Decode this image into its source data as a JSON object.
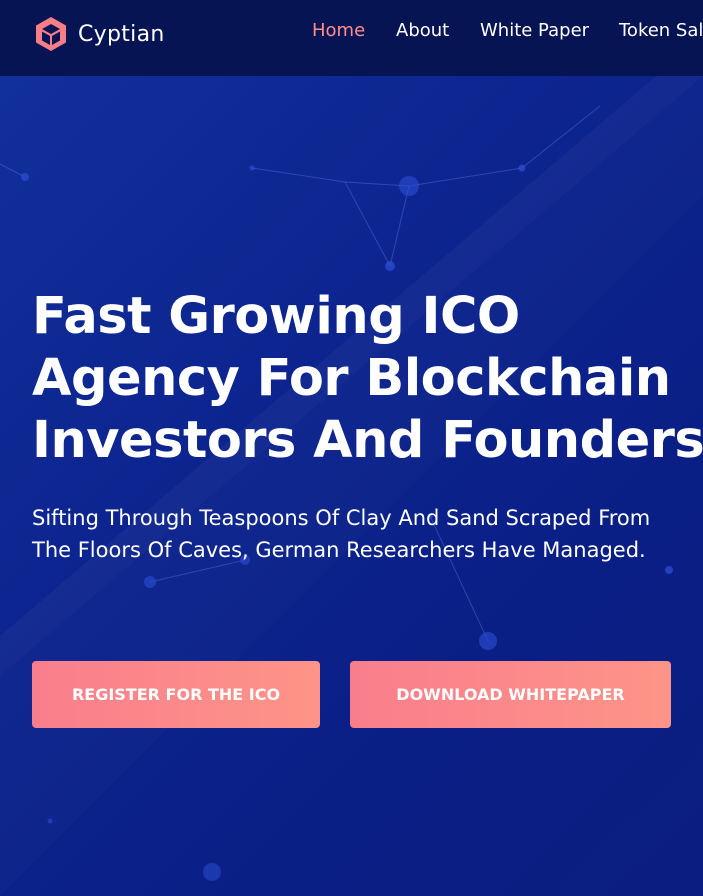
{
  "brand": {
    "name": "Cyptian",
    "icon": "hexagon-cube-logo-icon"
  },
  "nav": {
    "items": [
      {
        "label": "Home",
        "active": true
      },
      {
        "label": "About",
        "active": false
      },
      {
        "label": "White Paper",
        "active": false
      },
      {
        "label": "Token Sale",
        "active": false
      }
    ]
  },
  "hero": {
    "headline_lines": [
      "Fast Growing ICO",
      "Agency For Blockchain",
      "Investors And Founders"
    ],
    "subtitle": "Sifting Through Teaspoons Of Clay And Sand Scraped From The Floors Of Caves, German Researchers Have Managed.",
    "buttons": {
      "register": "REGISTER FOR THE ICO",
      "download": "DOWNLOAD WHITEPAPER"
    }
  },
  "colors": {
    "header_bg": "#071454",
    "hero_bg": "#0b1f85",
    "accent": "#ff8e8e",
    "button_gradient_start": "#f97e8c",
    "button_gradient_end": "#fe9488"
  }
}
